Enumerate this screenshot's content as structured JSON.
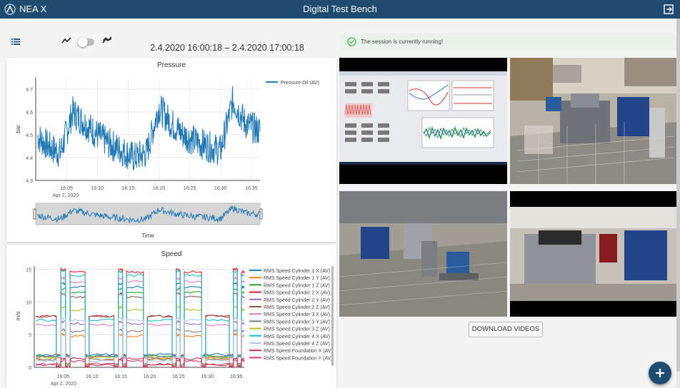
{
  "app": {
    "name": "NEA X",
    "title": "Digital Test Bench",
    "logo_icon": "nea-x-logo",
    "exit_icon": "exit-icon"
  },
  "toolbar": {
    "list_icon": "list-icon",
    "line_icon": "line-chart-icon",
    "trend_icon": "trend-chart-icon",
    "toggle_on": false
  },
  "time_range": "2.4.2020 16:00:18 – 2.4.2020 17:00:18",
  "status": {
    "icon": "check-circle-icon",
    "message": "The session is currently running!",
    "color": "#4caf50"
  },
  "pressure_chart": {
    "title": "Pressure",
    "ylabel": "bar",
    "xlabel": "Time",
    "date_label": "Apr 2, 2020"
  },
  "speed_chart": {
    "title": "Speed",
    "ylabel": "m/s",
    "date_label": "Apr 2, 2020"
  },
  "chart_data": [
    {
      "type": "line",
      "title": "Pressure",
      "ylabel": "bar",
      "xlabel": "Time",
      "ylim": [
        4.3,
        4.75
      ],
      "xlim": [
        "16:00:18",
        "17:00:18"
      ],
      "x_ticks": [
        "16:05",
        "16:10",
        "16:15",
        "16:20",
        "16:25",
        "16:30",
        "16:35"
      ],
      "y_ticks": [
        4.3,
        4.4,
        4.5,
        4.6,
        4.7
      ],
      "grid": true,
      "legend_position": "right",
      "series": [
        {
          "name": "Pressure Oil (AV)",
          "color": "#1f77b4",
          "x": [
            "16:00",
            "16:02",
            "16:04",
            "16:06",
            "16:08",
            "16:10",
            "16:12",
            "16:14",
            "16:16",
            "16:18",
            "16:20",
            "16:22",
            "16:24",
            "16:26",
            "16:28",
            "16:30",
            "16:32",
            "16:34",
            "16:36"
          ],
          "y": [
            4.5,
            4.45,
            4.42,
            4.6,
            4.55,
            4.5,
            4.46,
            4.43,
            4.4,
            4.42,
            4.62,
            4.55,
            4.5,
            4.47,
            4.45,
            4.43,
            4.65,
            4.55,
            4.52
          ]
        }
      ]
    },
    {
      "type": "line",
      "title": "Speed",
      "ylabel": "m/s",
      "ylim": [
        0,
        15.5
      ],
      "xlim": [
        "16:00:18",
        "17:00:18"
      ],
      "x_ticks": [
        "16:05",
        "16:10",
        "16:15",
        "16:20",
        "16:25",
        "16:30",
        "16:35"
      ],
      "y_ticks": [
        0,
        5,
        10,
        15
      ],
      "grid": true,
      "legend_position": "right",
      "series": [
        {
          "name": "RMS Speed Cylinder 1 X (AV)",
          "color": "#1f77b4",
          "low": 2.3,
          "high": 12.3
        },
        {
          "name": "RMS Speed Cylinder 1 Y (AV)",
          "color": "#ff7f0e",
          "low": 1.5,
          "high": 4.8
        },
        {
          "name": "RMS Speed Cylinder 1 Z (AV)",
          "color": "#2ca02c",
          "low": 2.0,
          "high": 11.5
        },
        {
          "name": "RMS Speed Cylinder 2 X (AV)",
          "color": "#d62728",
          "low": 9.2,
          "high": 14.6
        },
        {
          "name": "RMS Speed Cylinder 2 Y (AV)",
          "color": "#9467bd",
          "low": 1.9,
          "high": 6.7
        },
        {
          "name": "RMS Speed Cylinder 2 Z (AV)",
          "color": "#8c564b",
          "low": 9.2,
          "high": 10.8
        },
        {
          "name": "RMS Speed Cylinder 3 X (AV)",
          "color": "#e377c2",
          "low": 7.6,
          "high": 13.1
        },
        {
          "name": "RMS Speed Cylinder 3 Y (AV)",
          "color": "#7f7f7f",
          "low": 1.4,
          "high": 5.5
        },
        {
          "name": "RMS Speed Cylinder 3 Z (AV)",
          "color": "#bcbd22",
          "low": 1.8,
          "high": 8.8
        },
        {
          "name": "RMS Speed Cylinder 4 X (AV)",
          "color": "#17becf",
          "low": 8.5,
          "high": 14.1
        },
        {
          "name": "RMS Speed Cylinder 4 Z (AV)",
          "color": "#aec7e8",
          "low": 1.2,
          "high": 7.2
        },
        {
          "name": "RMS Speed Foundation X (AV)",
          "color": "#c0304f",
          "low": 0.4,
          "high": 1.3
        },
        {
          "name": "RMS Speed Foundation Y (AV)",
          "color": "#d43c6a",
          "low": 0.5,
          "high": 1.0
        }
      ]
    }
  ],
  "videos": [
    {
      "name": "monitor-screen-video"
    },
    {
      "name": "test-bench-overview-video"
    },
    {
      "name": "test-bench-side-video"
    },
    {
      "name": "test-bench-closeup-video"
    }
  ],
  "download_label": "DOWNLOAD VIDEOS",
  "fab": {
    "label": "+",
    "icon": "add-icon"
  }
}
